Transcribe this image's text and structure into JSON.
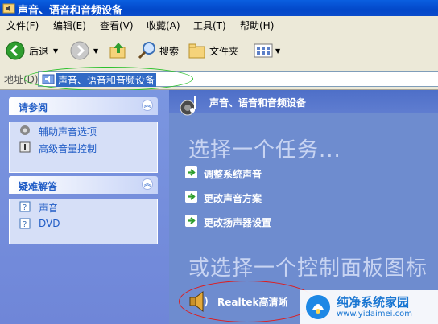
{
  "window": {
    "title": "声音、语音和音频设备"
  },
  "menu": [
    "文件(F)",
    "编辑(E)",
    "查看(V)",
    "收藏(A)",
    "工具(T)",
    "帮助(H)"
  ],
  "toolbar": {
    "back_label": "后退",
    "search_label": "搜索",
    "folders_label": "文件夹"
  },
  "address": {
    "label": "地址(D)",
    "value": "声音、语音和音频设备"
  },
  "see_also": {
    "title": "请参阅",
    "items": [
      {
        "label": "辅助声音选项",
        "icon": "accessibility-icon"
      },
      {
        "label": "高级音量控制",
        "icon": "volume-control-icon"
      }
    ]
  },
  "troubleshoot": {
    "title": "疑难解答",
    "items": [
      {
        "label": "声音",
        "icon": "help-icon"
      },
      {
        "label": "DVD",
        "icon": "help-icon"
      }
    ]
  },
  "main": {
    "header": "声音、语音和音频设备",
    "task_title": "选择一个任务...",
    "tasks": [
      "调整系统声音",
      "更改声音方案",
      "更改扬声器设置"
    ],
    "panel_title": "或选择一个控制面板图标",
    "realtek_label": "Realtek高清晰"
  },
  "watermark": {
    "name": "纯净系统家园",
    "url": "www.yidaimei.com"
  },
  "colors": {
    "titlebar": "#0348c9",
    "annotation_green": "#2cc12c",
    "annotation_red": "#e01b1b"
  }
}
